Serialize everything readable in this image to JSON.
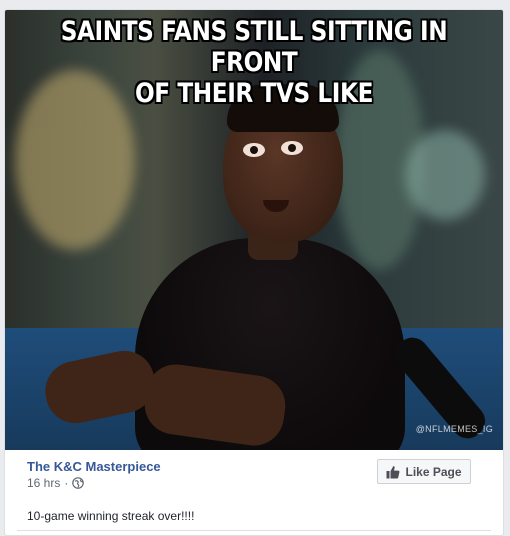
{
  "meme": {
    "caption_line1": "SAINTS FANS STILL SITTING IN FRONT",
    "caption_line2": "OF THEIR TVS LIKE",
    "watermark": "@NFLMEMES_IG"
  },
  "post": {
    "page_name": "The K&C Masterpiece",
    "time": "16 hrs",
    "separator": "·",
    "privacy_icon": "globe-icon",
    "like_page_label": "Like Page",
    "like_icon": "thumbs-up-icon",
    "text": "10-game winning streak over!!!!"
  },
  "colors": {
    "link": "#365899",
    "meta": "#616770",
    "background": "#e9ebee"
  }
}
